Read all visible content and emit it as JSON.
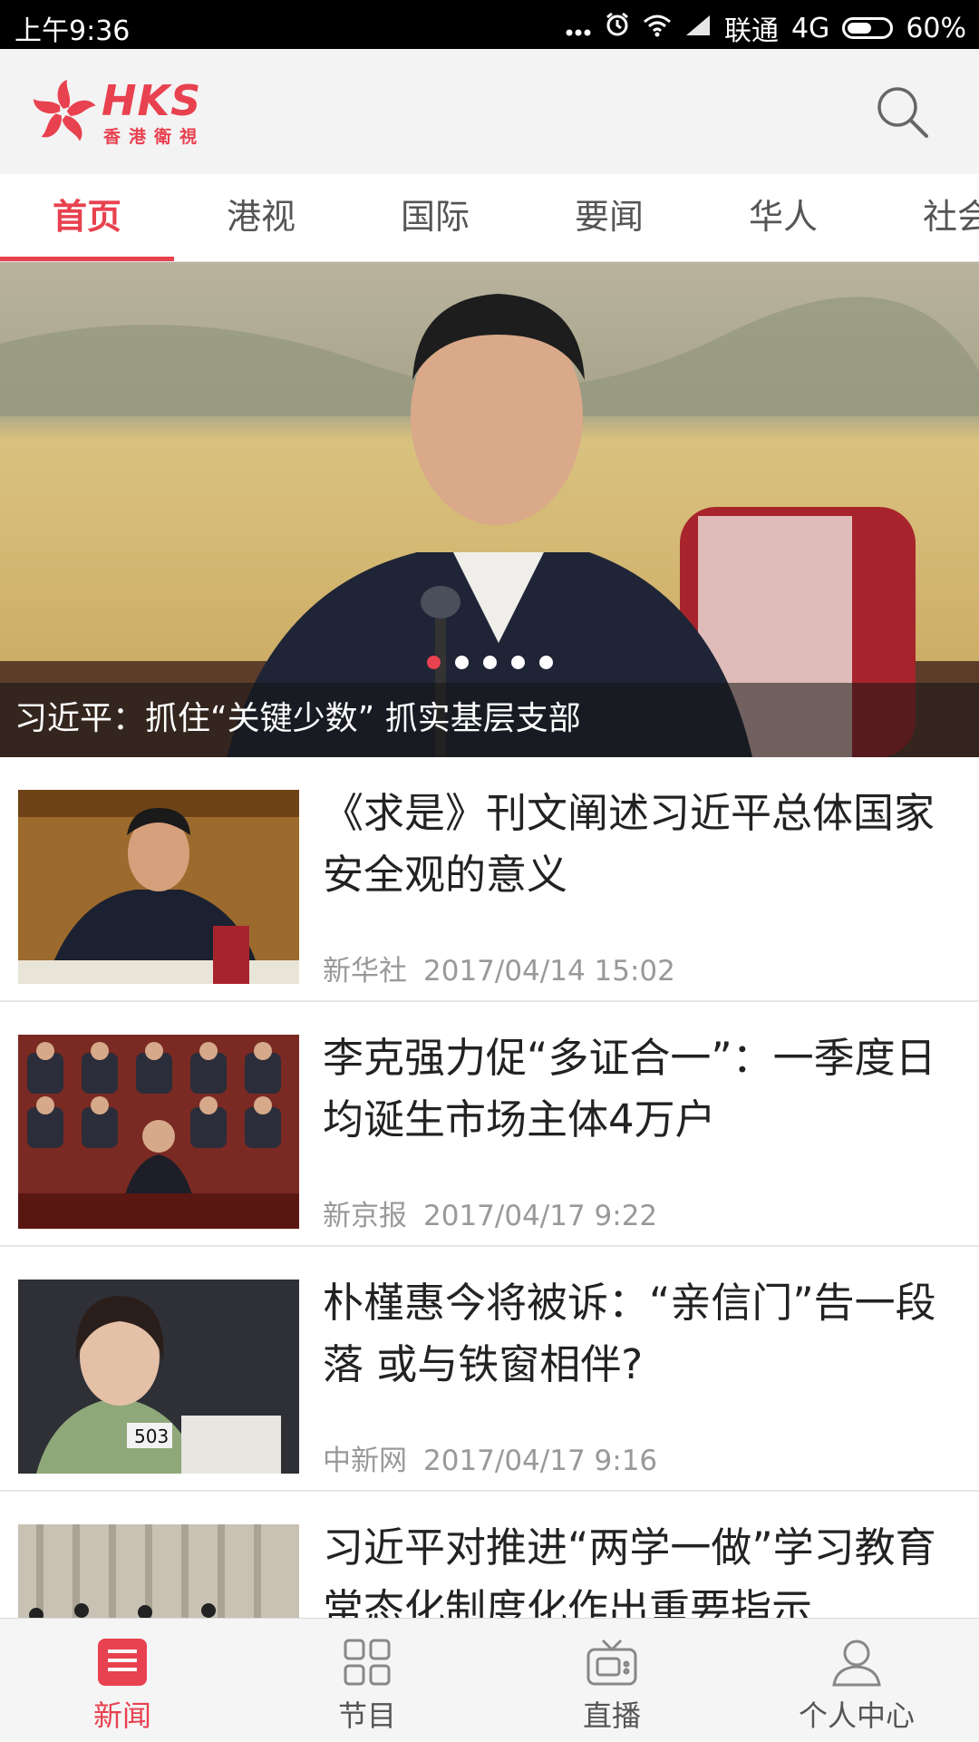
{
  "status_bar": {
    "time": "上午9:36",
    "carrier": "联通",
    "network": "4G",
    "battery": "60%",
    "battery_level": 0.6,
    "icons": [
      "more-dots-icon",
      "alarm-icon",
      "wifi-icon",
      "signal-icon",
      "battery-icon"
    ]
  },
  "header": {
    "logo_text": "HKS",
    "logo_subtitle": "香港衛視",
    "search_icon": "search-icon"
  },
  "tabs": [
    {
      "label": "首页",
      "active": true
    },
    {
      "label": "港视",
      "active": false
    },
    {
      "label": "国际",
      "active": false
    },
    {
      "label": "要闻",
      "active": false
    },
    {
      "label": "华人",
      "active": false
    },
    {
      "label": "社会",
      "active": false
    }
  ],
  "hero": {
    "caption": "习近平：抓住“关键少数” 抓实基层支部",
    "slide_count": 5,
    "active_slide": 1
  },
  "news": [
    {
      "title": "《求是》刊文阐述习近平总体国家安全观的意义",
      "source": "新华社",
      "time": "2017/04/14 15:02"
    },
    {
      "title": "李克强力促“多证合一”：一季度日均诞生市场主体4万户",
      "source": "新京报",
      "time": "2017/04/17 9:22"
    },
    {
      "title": "朴槿惠今将被诉：“亲信门”告一段落 或与铁窗相伴?",
      "source": "中新网",
      "time": "2017/04/17 9:16"
    },
    {
      "title": "习近平对推进“两学一做”学习教育常态化制度化作出重要指示",
      "source": "",
      "time": ""
    }
  ],
  "bottom_nav": [
    {
      "label": "新闻",
      "icon": "news-icon",
      "active": true
    },
    {
      "label": "节目",
      "icon": "grid-icon",
      "active": false
    },
    {
      "label": "直播",
      "icon": "tv-icon",
      "active": false
    },
    {
      "label": "个人中心",
      "icon": "user-icon",
      "active": false
    }
  ],
  "colors": {
    "accent": "#e8414f",
    "text_primary": "#222222",
    "text_secondary": "#999999"
  }
}
